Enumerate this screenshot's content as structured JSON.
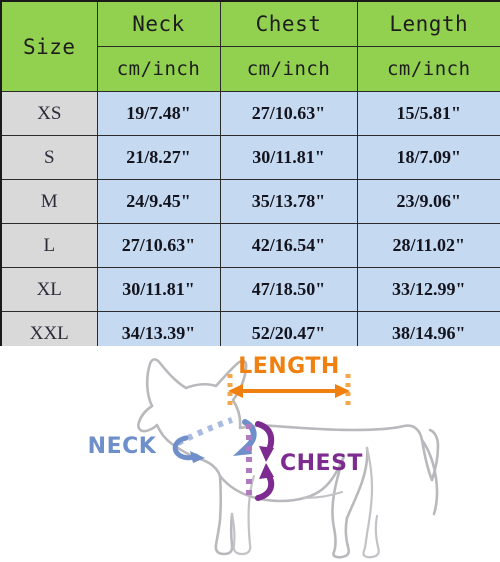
{
  "table": {
    "headers": {
      "size": "Size",
      "neck": "Neck",
      "chest": "Chest",
      "length": "Length",
      "unit_neck": "cm/inch",
      "unit_chest": "cm/inch",
      "unit_length": "cm/inch"
    },
    "columns": [
      "Size",
      "Neck",
      "Chest",
      "Length"
    ],
    "rows": [
      {
        "size": "XS",
        "neck": "19/7.48\"",
        "chest": "27/10.63\"",
        "length": "15/5.81\""
      },
      {
        "size": "S",
        "neck": "21/8.27\"",
        "chest": "30/11.81\"",
        "length": "18/7.09\""
      },
      {
        "size": "M",
        "neck": "24/9.45\"",
        "chest": "35/13.78\"",
        "length": "23/9.06\""
      },
      {
        "size": "L",
        "neck": "27/10.63\"",
        "chest": "42/16.54\"",
        "length": "28/11.02\""
      },
      {
        "size": "XL",
        "neck": "30/11.81\"",
        "chest": "47/18.50\"",
        "length": "33/12.99\""
      },
      {
        "size": "XXL",
        "neck": "34/13.39\"",
        "chest": "52/20.47\"",
        "length": "38/14.96\""
      }
    ],
    "colors": {
      "header_green": "#92d14f",
      "size_cell_gray": "#d9d9d9",
      "value_cell_blue": "#c5d9f1",
      "border": "#2b2b2b"
    }
  },
  "diagram": {
    "title_alt": "dog measurement diagram",
    "labels": {
      "length": "LENGTH",
      "neck": "NECK",
      "chest": "CHEST"
    },
    "colors": {
      "length": "#f08010",
      "neck": "#6f8fcb",
      "chest": "#7d2a91",
      "dog_outline": "#b9b9bd"
    }
  }
}
